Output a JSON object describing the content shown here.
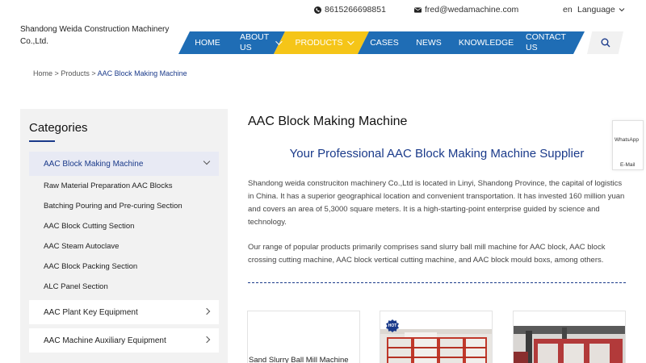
{
  "header": {
    "phone": "8615266698851",
    "email": "fred@wedamachine.com",
    "lang_code": "en",
    "lang_label": "Language",
    "company_name": "Shandong Weida Construction Machinery Co.,Ltd."
  },
  "nav": {
    "items": [
      {
        "label": "HOME"
      },
      {
        "label": "ABOUT US"
      },
      {
        "label": "PRODUCTS"
      },
      {
        "label": "CASES"
      },
      {
        "label": "NEWS"
      },
      {
        "label": "KNOWLEDGE"
      },
      {
        "label": "CONTACT US"
      }
    ],
    "colors": {
      "primary": "#1f6db5",
      "active": "#f5c518"
    }
  },
  "breadcrumb": {
    "home": "Home",
    "sep1": ">",
    "products": "Products",
    "sep2": ">",
    "current": "AAC Block Making Machine"
  },
  "sidebar": {
    "title": "Categories",
    "active_category": "AAC Block Making Machine",
    "subcategories": [
      "Raw Material Preparation AAC Blocks",
      "Batching Pouring and Pre-curing Section",
      "AAC Block Cutting Section",
      "AAC Steam Autoclave",
      "AAC Block Packing Section",
      "ALC Panel Section"
    ],
    "other_categories": [
      "AAC Plant Key Equipment",
      "AAC Machine Auxiliary Equipment"
    ]
  },
  "main": {
    "title": "AAC Block Making Machine",
    "subtitle": "Your Professional AAC Block Making Machine Supplier",
    "paragraph1": "Shandong weida construciton machinery Co.,Ltd is located in Linyi, Shandong Province, the capital of logistics in China. It has a superior geographical location and convenient transportation. It has invested 160 million yuan and covers an area of 5,3000 square meters. It is a high-starting-point enterprise guided by science and technology.",
    "paragraph2": "Our range of popular products primarily comprises sand slurry ball mill machine for AAC block, AAC block crossing cutting machine, AAC block vertical cutting machine, and AAC block mould boxs, among others."
  },
  "products": {
    "card1_label": "Sand Slurry Ball Mill Machine",
    "hot_badge": "HOT"
  },
  "side_widget": {
    "whatsapp": "WhatsApp",
    "email": "E-Mail"
  }
}
